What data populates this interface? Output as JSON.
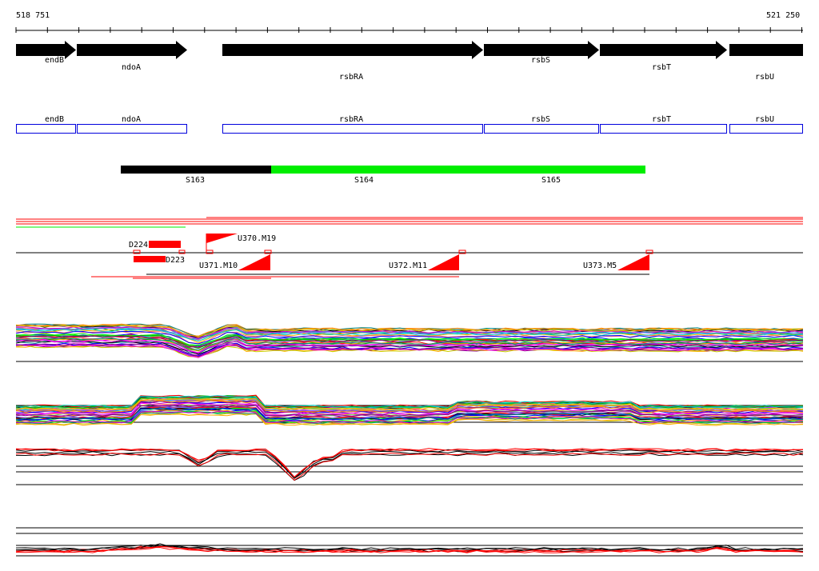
{
  "coords": {
    "start": "518 751",
    "end": "521 250"
  },
  "genes": [
    {
      "name": "endB",
      "from": 518751,
      "to": 518825
    },
    {
      "name": "ndoA",
      "from": 518826,
      "to": 519104
    },
    {
      "name": "rsbRA",
      "from": 519192,
      "to": 519840
    },
    {
      "name": "rsbS",
      "from": 519842,
      "to": 520129
    },
    {
      "name": "rsbT",
      "from": 520131,
      "to": 520450
    },
    {
      "name": "rsbU",
      "from": 520455,
      "to": 521250
    }
  ],
  "segments": [
    {
      "name": "S163",
      "color": "#000000"
    },
    {
      "name": "S164",
      "color": "#00ee00"
    },
    {
      "name": "S165",
      "color": "#00ee00"
    }
  ],
  "features": [
    "D224",
    "D223",
    "U370.M19",
    "U371.M10",
    "U372.M11",
    "U373.M5"
  ],
  "colors": {
    "gene_box": "#0000dd",
    "feature": "#ff0000",
    "segment_green": "#00ee00"
  }
}
